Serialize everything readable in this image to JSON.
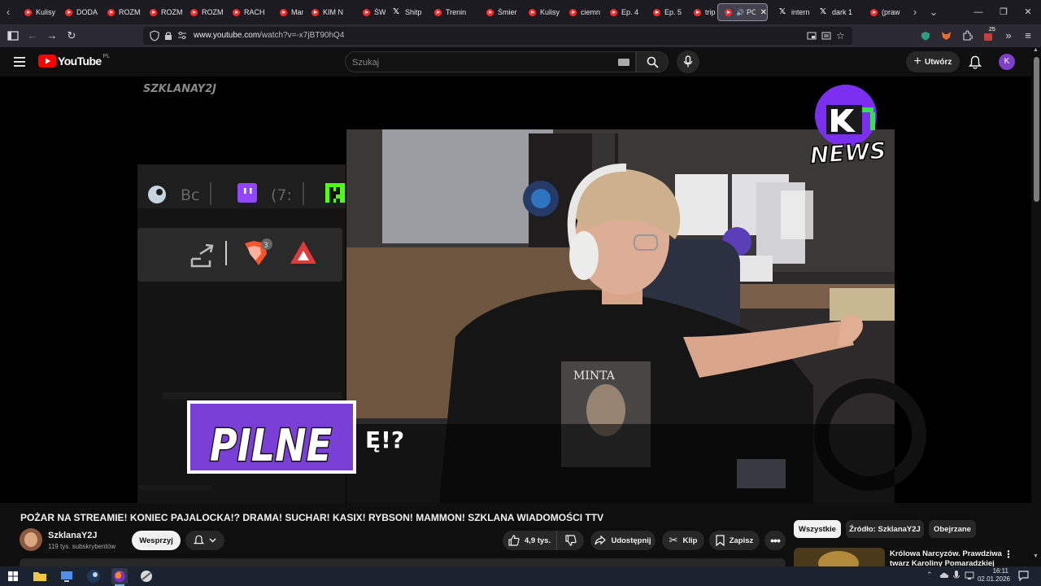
{
  "browser": {
    "tabs": [
      {
        "label": "Kulisy",
        "icon": "youtube-icon"
      },
      {
        "label": "DODA",
        "icon": "youtube-icon"
      },
      {
        "label": "ROZM",
        "icon": "youtube-icon"
      },
      {
        "label": "ROZM",
        "icon": "youtube-icon"
      },
      {
        "label": "ROZM",
        "icon": "youtube-icon"
      },
      {
        "label": "RACH",
        "icon": "youtube-icon"
      },
      {
        "label": "Mamm",
        "icon": "youtube-icon"
      },
      {
        "label": "KIM N",
        "icon": "youtube-icon"
      },
      {
        "label": "ŚWIĄ",
        "icon": "youtube-icon"
      },
      {
        "label": "Shitp",
        "icon": "x-icon"
      },
      {
        "label": "Trenin",
        "icon": "youtube-icon"
      },
      {
        "label": "Śmier",
        "icon": "youtube-icon"
      },
      {
        "label": "Kulisy",
        "icon": "youtube-icon"
      },
      {
        "label": "ciemn",
        "icon": "youtube-icon"
      },
      {
        "label": "Ep. 4",
        "icon": "youtube-icon"
      },
      {
        "label": "Ep. 5",
        "icon": "youtube-icon"
      },
      {
        "label": "trip -",
        "icon": "youtube-icon"
      },
      {
        "label": "PO",
        "icon": "youtube-icon",
        "active": true
      },
      {
        "label": "intern",
        "icon": "x-icon"
      },
      {
        "label": "dark 1",
        "icon": "x-icon"
      },
      {
        "label": "(praw",
        "icon": "youtube-icon"
      }
    ],
    "url_host": "www.youtube.com",
    "url_path": "/watch?v=-x7jBT90hQ4",
    "extension_badge": "25"
  },
  "youtube": {
    "logo_text": "YouTube",
    "region": "PL",
    "search_placeholder": "Szukaj",
    "create_label": "Utwórz",
    "avatar_letter": "K"
  },
  "video_frame": {
    "channel_watermark": "SZKLANAY2J",
    "news_badge": "NEWS",
    "pilne_label": "PILNE",
    "subtitle_fragment": "Ę!?",
    "shirt_text": "MINTA",
    "overlay_text_1": "Bc",
    "overlay_text_2": "(7:",
    "notification_count": "3"
  },
  "video": {
    "title": "POŻAR NA STREAMIE! KONIEC PAJALOCKA!? DRAMA! SUCHAR! KASIX! RYBSON! MAMMON! SZKLANA WIADOMOŚCI TTV",
    "channel_name": "SzklanaY2J",
    "subscribers": "119 tys. subskrybentów",
    "support_label": "Wesprzyj",
    "likes": "4,9 tys.",
    "share_label": "Udostępnij",
    "clip_label": "Klip",
    "save_label": "Zapisz"
  },
  "sidebar": {
    "chips": [
      "Wszystkie",
      "Źródło: SzklanaY2J",
      "Obejrzane"
    ],
    "rec_title_line1": "Królowa Narcyzów. Prawdziwa",
    "rec_title_line2": "twarz Karoliny Pomaradzkiej"
  },
  "taskbar": {
    "time": "16:11",
    "date": "02.01.2026"
  }
}
